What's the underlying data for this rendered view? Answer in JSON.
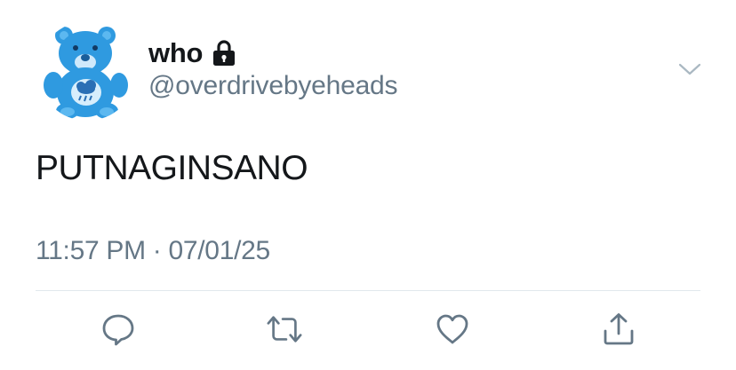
{
  "tweet": {
    "display_name": "who",
    "handle": "@overdrivebyeheads",
    "text": "PUTNAGINSANO",
    "time": "11:57 PM",
    "separator": "·",
    "date": "07/01/25",
    "protected": true
  },
  "icons": {
    "avatar": "blue-care-bear-avatar",
    "lock": "lock-icon",
    "menu": "chevron-down-icon",
    "reply": "reply-icon",
    "retweet": "retweet-icon",
    "like": "heart-icon",
    "share": "share-icon"
  },
  "colors": {
    "primary_text": "#14171a",
    "secondary_text": "#657786",
    "icon": "#657786",
    "divider": "#e1e8ed",
    "avatar_blue": "#2f9ae0"
  }
}
